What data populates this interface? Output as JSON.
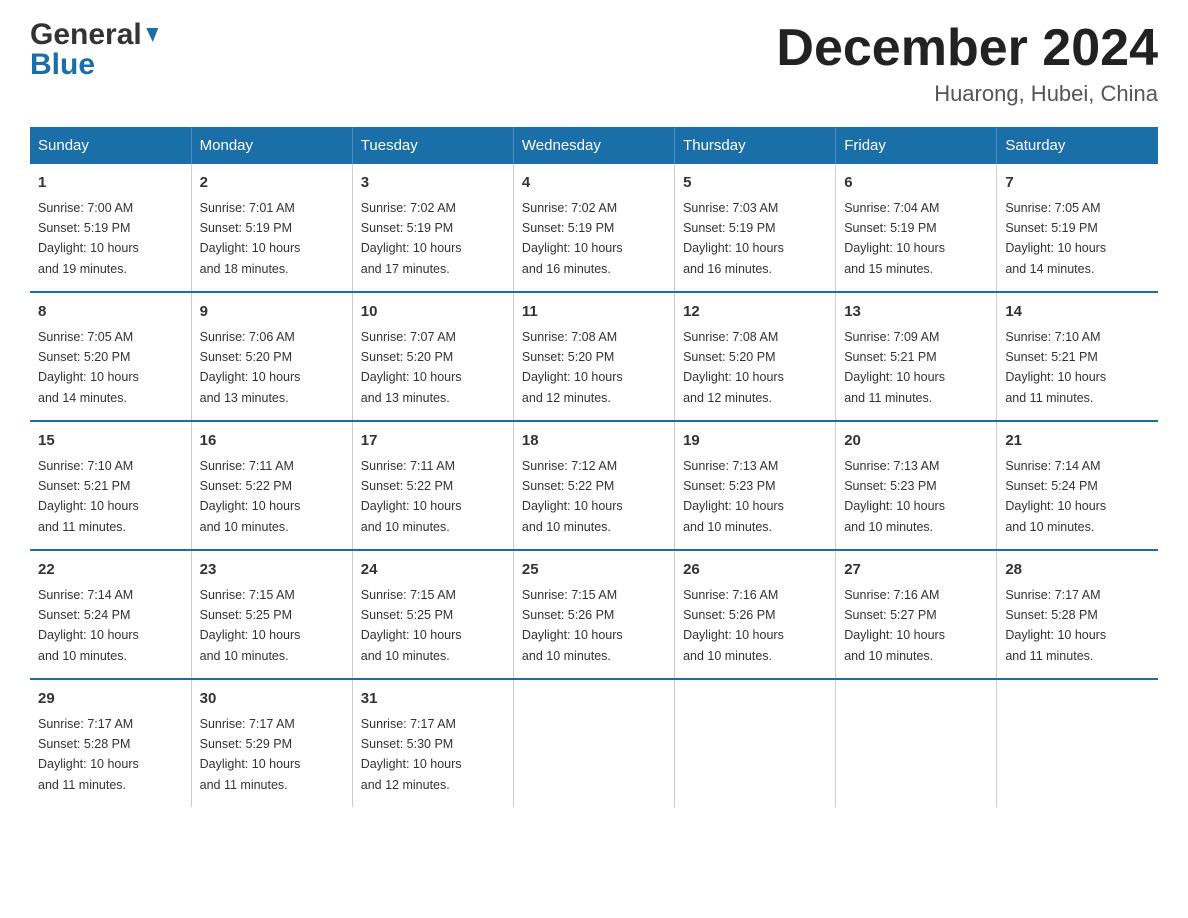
{
  "logo": {
    "general": "General",
    "blue": "Blue"
  },
  "title": "December 2024",
  "subtitle": "Huarong, Hubei, China",
  "days_header": [
    "Sunday",
    "Monday",
    "Tuesday",
    "Wednesday",
    "Thursday",
    "Friday",
    "Saturday"
  ],
  "weeks": [
    [
      {
        "num": "1",
        "sunrise": "7:00 AM",
        "sunset": "5:19 PM",
        "daylight": "10 hours and 19 minutes."
      },
      {
        "num": "2",
        "sunrise": "7:01 AM",
        "sunset": "5:19 PM",
        "daylight": "10 hours and 18 minutes."
      },
      {
        "num": "3",
        "sunrise": "7:02 AM",
        "sunset": "5:19 PM",
        "daylight": "10 hours and 17 minutes."
      },
      {
        "num": "4",
        "sunrise": "7:02 AM",
        "sunset": "5:19 PM",
        "daylight": "10 hours and 16 minutes."
      },
      {
        "num": "5",
        "sunrise": "7:03 AM",
        "sunset": "5:19 PM",
        "daylight": "10 hours and 16 minutes."
      },
      {
        "num": "6",
        "sunrise": "7:04 AM",
        "sunset": "5:19 PM",
        "daylight": "10 hours and 15 minutes."
      },
      {
        "num": "7",
        "sunrise": "7:05 AM",
        "sunset": "5:19 PM",
        "daylight": "10 hours and 14 minutes."
      }
    ],
    [
      {
        "num": "8",
        "sunrise": "7:05 AM",
        "sunset": "5:20 PM",
        "daylight": "10 hours and 14 minutes."
      },
      {
        "num": "9",
        "sunrise": "7:06 AM",
        "sunset": "5:20 PM",
        "daylight": "10 hours and 13 minutes."
      },
      {
        "num": "10",
        "sunrise": "7:07 AM",
        "sunset": "5:20 PM",
        "daylight": "10 hours and 13 minutes."
      },
      {
        "num": "11",
        "sunrise": "7:08 AM",
        "sunset": "5:20 PM",
        "daylight": "10 hours and 12 minutes."
      },
      {
        "num": "12",
        "sunrise": "7:08 AM",
        "sunset": "5:20 PM",
        "daylight": "10 hours and 12 minutes."
      },
      {
        "num": "13",
        "sunrise": "7:09 AM",
        "sunset": "5:21 PM",
        "daylight": "10 hours and 11 minutes."
      },
      {
        "num": "14",
        "sunrise": "7:10 AM",
        "sunset": "5:21 PM",
        "daylight": "10 hours and 11 minutes."
      }
    ],
    [
      {
        "num": "15",
        "sunrise": "7:10 AM",
        "sunset": "5:21 PM",
        "daylight": "10 hours and 11 minutes."
      },
      {
        "num": "16",
        "sunrise": "7:11 AM",
        "sunset": "5:22 PM",
        "daylight": "10 hours and 10 minutes."
      },
      {
        "num": "17",
        "sunrise": "7:11 AM",
        "sunset": "5:22 PM",
        "daylight": "10 hours and 10 minutes."
      },
      {
        "num": "18",
        "sunrise": "7:12 AM",
        "sunset": "5:22 PM",
        "daylight": "10 hours and 10 minutes."
      },
      {
        "num": "19",
        "sunrise": "7:13 AM",
        "sunset": "5:23 PM",
        "daylight": "10 hours and 10 minutes."
      },
      {
        "num": "20",
        "sunrise": "7:13 AM",
        "sunset": "5:23 PM",
        "daylight": "10 hours and 10 minutes."
      },
      {
        "num": "21",
        "sunrise": "7:14 AM",
        "sunset": "5:24 PM",
        "daylight": "10 hours and 10 minutes."
      }
    ],
    [
      {
        "num": "22",
        "sunrise": "7:14 AM",
        "sunset": "5:24 PM",
        "daylight": "10 hours and 10 minutes."
      },
      {
        "num": "23",
        "sunrise": "7:15 AM",
        "sunset": "5:25 PM",
        "daylight": "10 hours and 10 minutes."
      },
      {
        "num": "24",
        "sunrise": "7:15 AM",
        "sunset": "5:25 PM",
        "daylight": "10 hours and 10 minutes."
      },
      {
        "num": "25",
        "sunrise": "7:15 AM",
        "sunset": "5:26 PM",
        "daylight": "10 hours and 10 minutes."
      },
      {
        "num": "26",
        "sunrise": "7:16 AM",
        "sunset": "5:26 PM",
        "daylight": "10 hours and 10 minutes."
      },
      {
        "num": "27",
        "sunrise": "7:16 AM",
        "sunset": "5:27 PM",
        "daylight": "10 hours and 10 minutes."
      },
      {
        "num": "28",
        "sunrise": "7:17 AM",
        "sunset": "5:28 PM",
        "daylight": "10 hours and 11 minutes."
      }
    ],
    [
      {
        "num": "29",
        "sunrise": "7:17 AM",
        "sunset": "5:28 PM",
        "daylight": "10 hours and 11 minutes."
      },
      {
        "num": "30",
        "sunrise": "7:17 AM",
        "sunset": "5:29 PM",
        "daylight": "10 hours and 11 minutes."
      },
      {
        "num": "31",
        "sunrise": "7:17 AM",
        "sunset": "5:30 PM",
        "daylight": "10 hours and 12 minutes."
      },
      null,
      null,
      null,
      null
    ]
  ],
  "labels": {
    "sunrise_prefix": "Sunrise: ",
    "sunset_prefix": "Sunset: ",
    "daylight_prefix": "Daylight: "
  }
}
